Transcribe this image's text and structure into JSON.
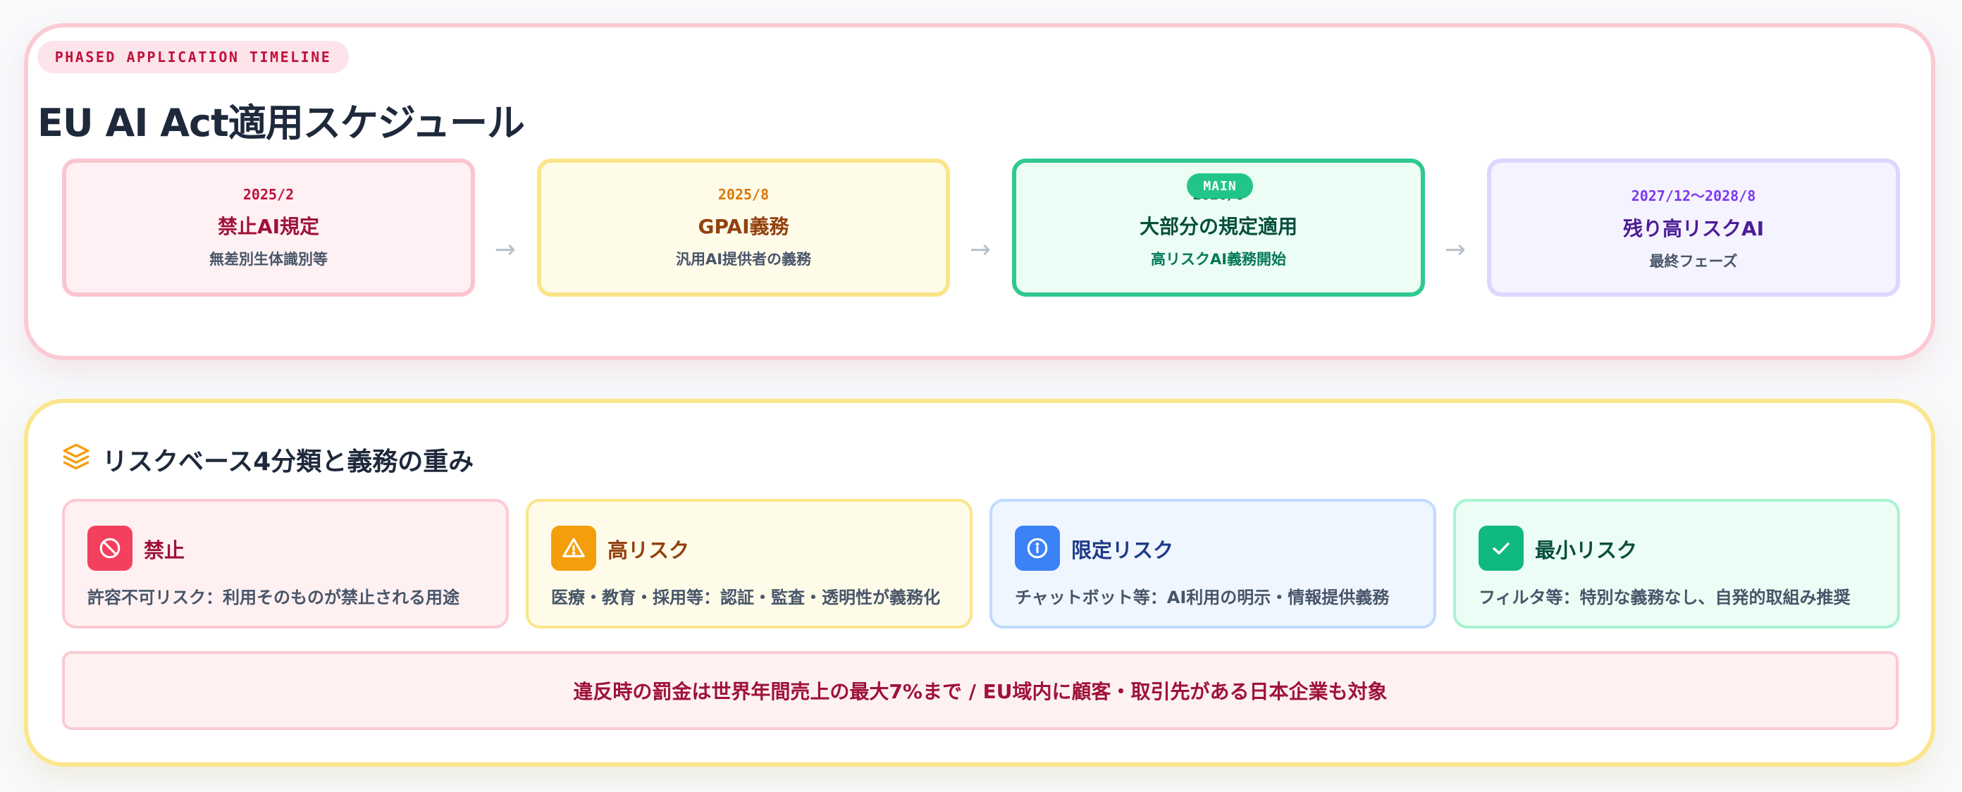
{
  "timeline": {
    "tag": "PHASED APPLICATION TIMELINE",
    "title": "EU AI Act適用スケジュール",
    "main_badge": "MAIN",
    "phases": [
      {
        "date": "2025/2",
        "title": "禁止AI規定",
        "sub": "無差別生体識別等"
      },
      {
        "date": "2025/8",
        "title": "GPAI義務",
        "sub": "汎用AI提供者の義務"
      },
      {
        "date": "2026/8",
        "title": "大部分の規定適用",
        "sub": "高リスクAI義務開始"
      },
      {
        "date": "2027/12〜2028/8",
        "title": "残り高リスクAI",
        "sub": "最終フェーズ"
      }
    ]
  },
  "risk": {
    "title": "リスクベース4分類と義務の重み",
    "icon": "layers-icon",
    "categories": [
      {
        "name": "禁止",
        "desc": "許容不可リスク：利用そのものが禁止される用途",
        "icon": "ban-icon",
        "color": "#f43f5e"
      },
      {
        "name": "高リスク",
        "desc": "医療・教育・採用等：認証・監査・透明性が義務化",
        "icon": "warning-icon",
        "color": "#f59e0b"
      },
      {
        "name": "限定リスク",
        "desc": "チャットボット等：AI利用の明示・情報提供義務",
        "icon": "info-icon",
        "color": "#3b82f6"
      },
      {
        "name": "最小リスク",
        "desc": "フィルタ等：特別な義務なし、自発的取組み推奨",
        "icon": "check-icon",
        "color": "#10b981"
      }
    ],
    "banner": "違反時の罰金は世界年間売上の最大7%まで / EU域内に顧客・取引先がある日本企業も対象"
  }
}
